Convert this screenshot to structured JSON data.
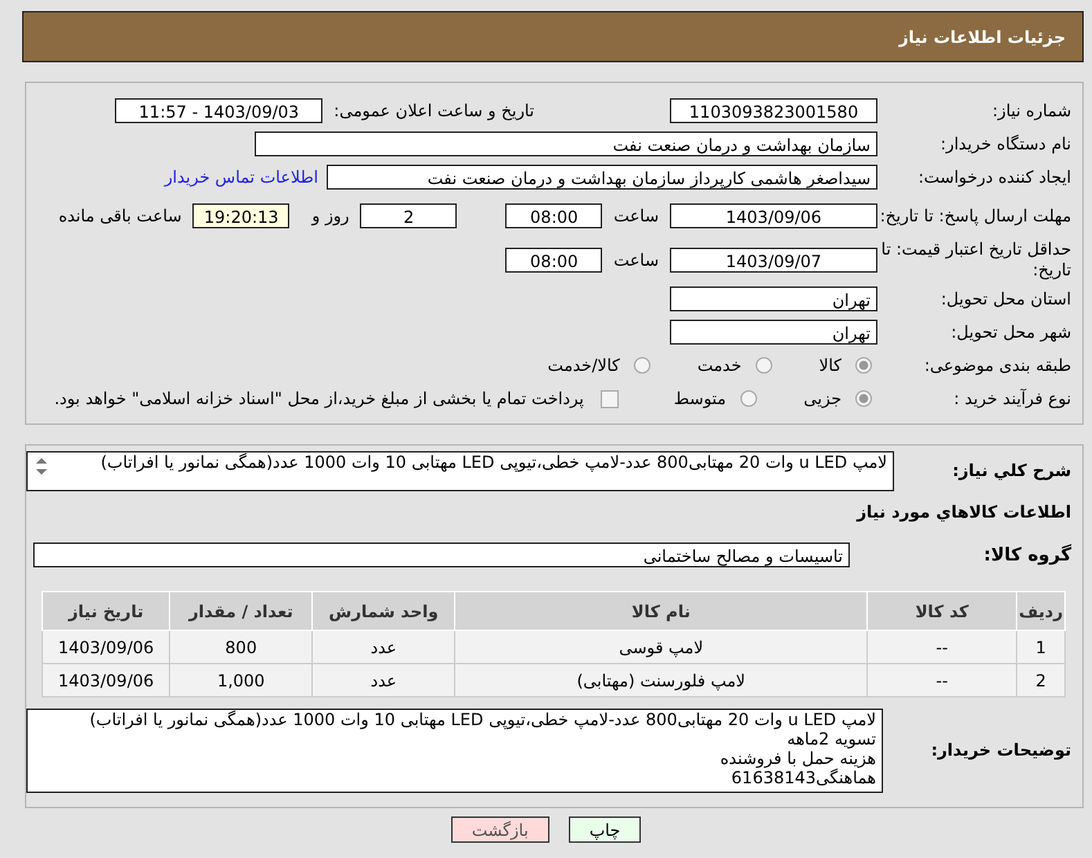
{
  "header": {
    "title": "جزئیات اطلاعات نیاز"
  },
  "need_number": {
    "label": "شماره نیاز:",
    "value": "1103093823001580"
  },
  "announce": {
    "label": "تاریخ و ساعت اعلان عمومی:",
    "value": "1403/09/03 - 11:57"
  },
  "buyer_org": {
    "label": "نام دستگاه خریدار:",
    "value": "سازمان بهداشت و درمان صنعت نفت"
  },
  "requester": {
    "label": "ایجاد کننده درخواست:",
    "value": "سیداصغر هاشمی کارپرداز سازمان بهداشت و درمان صنعت نفت",
    "link": "اطلاعات تماس خریدار"
  },
  "deadline": {
    "label": "مهلت ارسال پاسخ: تا تاریخ:",
    "date": "1403/09/06",
    "time_label": "ساعت",
    "time": "08:00",
    "days": "2",
    "days_label": "روز و",
    "remaining": "19:20:13",
    "remaining_label": "ساعت باقی مانده"
  },
  "validity": {
    "label": "حداقل تاریخ اعتبار قیمت: تا تاریخ:",
    "date": "1403/09/07",
    "time_label": "ساعت",
    "time": "08:00"
  },
  "province": {
    "label": "استان محل تحویل:",
    "value": "تهران"
  },
  "city": {
    "label": "شهر محل تحویل:",
    "value": "تهران"
  },
  "category": {
    "label": "طبقه بندی موضوعی:",
    "options": [
      {
        "label": "کالا",
        "selected": true
      },
      {
        "label": "خدمت",
        "selected": false
      },
      {
        "label": "کالا/خدمت",
        "selected": false
      }
    ]
  },
  "process": {
    "label": "نوع فرآیند خرید :",
    "options": [
      {
        "label": "جزیی",
        "selected": true
      },
      {
        "label": "متوسط",
        "selected": false
      }
    ],
    "treasury": {
      "label": "پرداخت تمام یا بخشی از مبلغ خرید،از محل \"اسناد خزانه اسلامی\" خواهد بود.",
      "checked": false
    }
  },
  "description": {
    "label": "شرح کلي نیاز:",
    "value": "لامپ u LED وات 20 مهتابی800 عدد-لامپ خطی،تیوپی LED مهتابی 10 وات 1000 عدد(همگی نمانور یا افراتاب)"
  },
  "goods_title": "اطلاعات کالاهاي مورد نیاز",
  "goods_group": {
    "label": "گروه کالا:",
    "value": "تاسیسات و مصالح ساختمانی"
  },
  "table": {
    "columns": [
      "ردیف",
      "کد کالا",
      "نام کالا",
      "واحد شمارش",
      "تعداد / مقدار",
      "تاریخ نیاز"
    ],
    "rows": [
      [
        "1",
        "--",
        "لامپ قوسی",
        "عدد",
        "800",
        "1403/09/06"
      ],
      [
        "2",
        "--",
        "لامپ فلورسنت (مهتابی)",
        "عدد",
        "1,000",
        "1403/09/06"
      ]
    ]
  },
  "buyer_notes": {
    "label": "توضیحات خریدار:",
    "lines": [
      "لامپ u LED وات 20 مهتابی800 عدد-لامپ خطی،تیوپی LED مهتابی 10 وات 1000 عدد(همگی نمانور یا افراتاب)",
      "تسویه 2ماهه",
      "هزینه حمل با فروشنده",
      "هماهنگی61638143"
    ]
  },
  "buttons": [
    {
      "label": "چاپ",
      "kind": "print"
    },
    {
      "label": "بازگشت",
      "kind": "back"
    }
  ]
}
